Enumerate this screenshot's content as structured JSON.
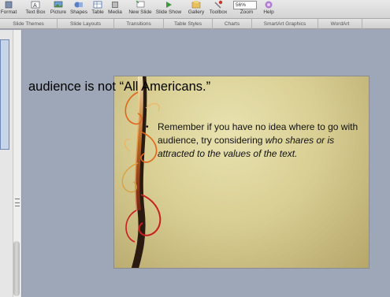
{
  "toolbar": {
    "buttons": [
      {
        "label": "Format",
        "icon": "format-icon"
      },
      {
        "label": "Text Box",
        "icon": "text-box-icon"
      },
      {
        "label": "Picture",
        "icon": "picture-icon"
      },
      {
        "label": "Shapes",
        "icon": "shapes-icon"
      },
      {
        "label": "Table",
        "icon": "table-icon"
      },
      {
        "label": "Media",
        "icon": "media-icon"
      },
      {
        "label": "New Slide",
        "icon": "new-slide-icon"
      },
      {
        "label": "Slide Show",
        "icon": "slide-show-icon"
      },
      {
        "label": "Gallery",
        "icon": "gallery-icon"
      },
      {
        "label": "Toolbox",
        "icon": "toolbox-icon"
      },
      {
        "label": "Zoom",
        "icon": "zoom-icon"
      },
      {
        "label": "Help",
        "icon": "help-icon"
      }
    ],
    "zoom_value": "56%"
  },
  "ribbon": {
    "tabs": [
      "Slide Themes",
      "Slide Layouts",
      "Transitions",
      "Table Styles",
      "Charts",
      "SmartArt Graphics",
      "WordArt"
    ]
  },
  "editor": {
    "overflow_title": "audience is not “All Americans.”",
    "bullet": {
      "plain": "Remember if you have no idea where to go with audience, try considering ",
      "italic": "who shares or is attracted to the values of the text."
    }
  },
  "colors": {
    "slide_bg": "#d9cf94",
    "vine_orange": "#e0661c",
    "vine_red": "#c81e1e",
    "vine_dark": "#2a1a10",
    "canvas_bg": "#9ea7b7"
  }
}
